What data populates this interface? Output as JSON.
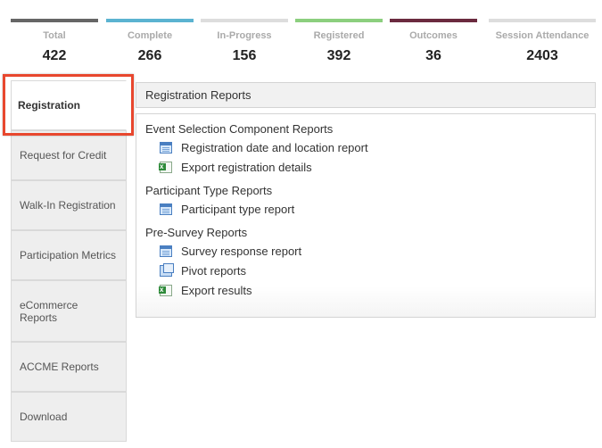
{
  "stats": [
    {
      "label": "Total",
      "value": "422",
      "color": "#666666"
    },
    {
      "label": "Complete",
      "value": "266",
      "color": "#5bb3d1"
    },
    {
      "label": "In-Progress",
      "value": "156",
      "color": "#dddddd"
    },
    {
      "label": "Registered",
      "value": "392",
      "color": "#8ccf7e"
    },
    {
      "label": "Outcomes",
      "value": "36",
      "color": "#6b2a3f"
    },
    {
      "label": "Session Attendance",
      "value": "2403",
      "color": "#dddddd"
    }
  ],
  "sidebar": {
    "items": [
      {
        "label": "Registration"
      },
      {
        "label": "Request for Credit"
      },
      {
        "label": "Walk-In Registration"
      },
      {
        "label": "Participation Metrics"
      },
      {
        "label": "eCommerce Reports"
      },
      {
        "label": "ACCME Reports"
      },
      {
        "label": "Download"
      }
    ]
  },
  "panel": {
    "title": "Registration Reports",
    "groups": [
      {
        "title": "Event Selection Component Reports",
        "items": [
          {
            "label": "Registration date and location report",
            "icon": "report-icon"
          },
          {
            "label": "Export registration details",
            "icon": "excel-icon"
          }
        ]
      },
      {
        "title": "Participant Type Reports",
        "items": [
          {
            "label": "Participant type report",
            "icon": "report-icon"
          }
        ]
      },
      {
        "title": "Pre-Survey Reports",
        "items": [
          {
            "label": "Survey response report",
            "icon": "report-icon"
          },
          {
            "label": "Pivot reports",
            "icon": "pivot-icon"
          },
          {
            "label": "Export results",
            "icon": "excel-icon"
          }
        ]
      }
    ]
  }
}
